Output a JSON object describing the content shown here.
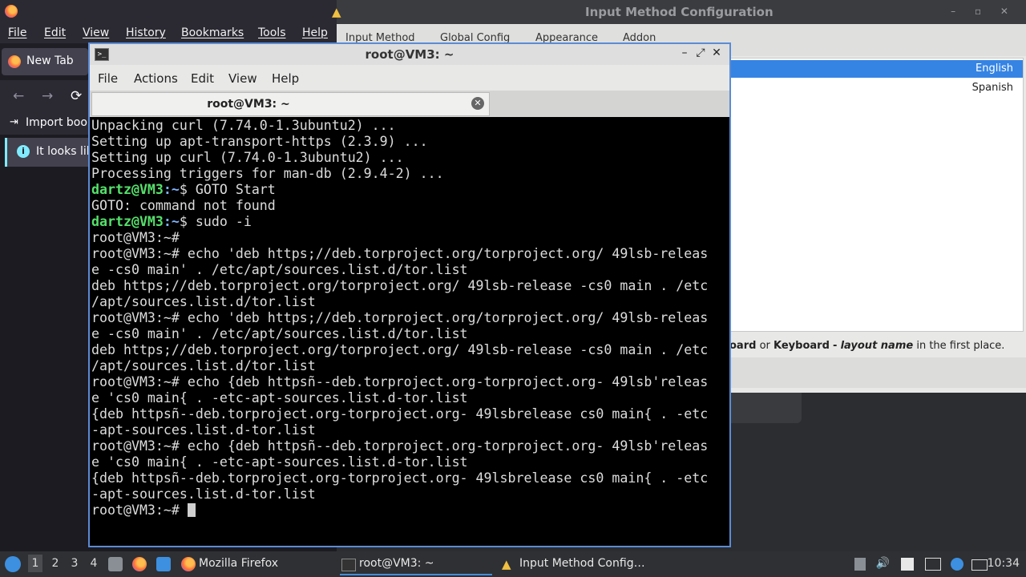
{
  "firefox": {
    "menu": [
      "File",
      "Edit",
      "View",
      "History",
      "Bookmarks",
      "Tools",
      "Help"
    ],
    "tab_label": "New Tab",
    "nav_back": "←",
    "nav_forward": "→",
    "nav_reload": "⟳",
    "bookmark_label": "Import book",
    "bookmark_icon": "⇥",
    "notice_text": "It looks lik",
    "notice_icon": "i"
  },
  "imc": {
    "title": "Input Method Configuration",
    "controls": "– ▫ ✕",
    "tabs": [
      "Input Method",
      "Global Config",
      "Appearance",
      "Addon"
    ],
    "items": [
      "English",
      "Spanish"
    ],
    "help_prefix": "oard",
    "help_or": "or",
    "help_keyboard": "Keyboard",
    "help_dash": "-",
    "help_layout": "layout name",
    "help_suffix": "in the first place."
  },
  "terminal": {
    "title": "root@VM3: ~",
    "icon_text": ">_",
    "controls": [
      "–",
      "⤢",
      "✕"
    ],
    "menu": [
      "File",
      "Actions",
      "Edit",
      "View",
      "Help"
    ],
    "tab_label": "root@VM3: ~",
    "tab_close": "✕",
    "lines": [
      {
        "type": "text",
        "text": "Unpacking curl (7.74.0-1.3ubuntu2) ..."
      },
      {
        "type": "text",
        "text": "Setting up apt-transport-https (2.3.9) ..."
      },
      {
        "type": "text",
        "text": "Setting up curl (7.74.0-1.3ubuntu2) ..."
      },
      {
        "type": "text",
        "text": "Processing triggers for man-db (2.9.4-2) ..."
      },
      {
        "type": "user",
        "user": "dartz@VM3",
        "path": ":~",
        "cmd": "$ GOTO Start"
      },
      {
        "type": "text",
        "text": "GOTO: command not found"
      },
      {
        "type": "user",
        "user": "dartz@VM3",
        "path": ":~",
        "cmd": "$ sudo -i"
      },
      {
        "type": "text",
        "text": "root@VM3:~#"
      },
      {
        "type": "text",
        "text": "root@VM3:~# echo 'deb https;//deb.torproject.org/torproject.org/ 49lsb-releas"
      },
      {
        "type": "text",
        "text": "e -cs0 main' . /etc/apt/sources.list.d/tor.list"
      },
      {
        "type": "text",
        "text": "deb https;//deb.torproject.org/torproject.org/ 49lsb-release -cs0 main . /etc"
      },
      {
        "type": "text",
        "text": "/apt/sources.list.d/tor.list"
      },
      {
        "type": "text",
        "text": "root@VM3:~# echo 'deb https;//deb.torproject.org/torproject.org/ 49lsb-releas"
      },
      {
        "type": "text",
        "text": "e -cs0 main' . /etc/apt/sources.list.d/tor.list"
      },
      {
        "type": "text",
        "text": "deb https;//deb.torproject.org/torproject.org/ 49lsb-release -cs0 main . /etc"
      },
      {
        "type": "text",
        "text": "/apt/sources.list.d/tor.list"
      },
      {
        "type": "text",
        "text": "root@VM3:~# echo {deb httpsñ--deb.torproject.org-torproject.org- 49lsb'releas"
      },
      {
        "type": "text",
        "text": "e 'cs0 main{ . -etc-apt-sources.list.d-tor.list"
      },
      {
        "type": "text",
        "text": "{deb httpsñ--deb.torproject.org-torproject.org- 49lsbrelease cs0 main{ . -etc"
      },
      {
        "type": "text",
        "text": "-apt-sources.list.d-tor.list"
      },
      {
        "type": "text",
        "text": "root@VM3:~# echo {deb httpsñ--deb.torproject.org-torproject.org- 49lsb'releas"
      },
      {
        "type": "text",
        "text": "e 'cs0 main{ . -etc-apt-sources.list.d-tor.list"
      },
      {
        "type": "text",
        "text": "{deb httpsñ--deb.torproject.org-torproject.org- 49lsbrelease cs0 main{ . -etc"
      },
      {
        "type": "text",
        "text": "-apt-sources.list.d-tor.list"
      },
      {
        "type": "prompt",
        "text": "root@VM3:~# "
      }
    ]
  },
  "taskbar": {
    "workspaces": [
      "1",
      "2",
      "3",
      "4"
    ],
    "tasks": [
      "Mozilla Firefox",
      "root@VM3: ~",
      "Input Method Config…"
    ],
    "clock": "10:34",
    "accent": "#3d8fe0"
  }
}
